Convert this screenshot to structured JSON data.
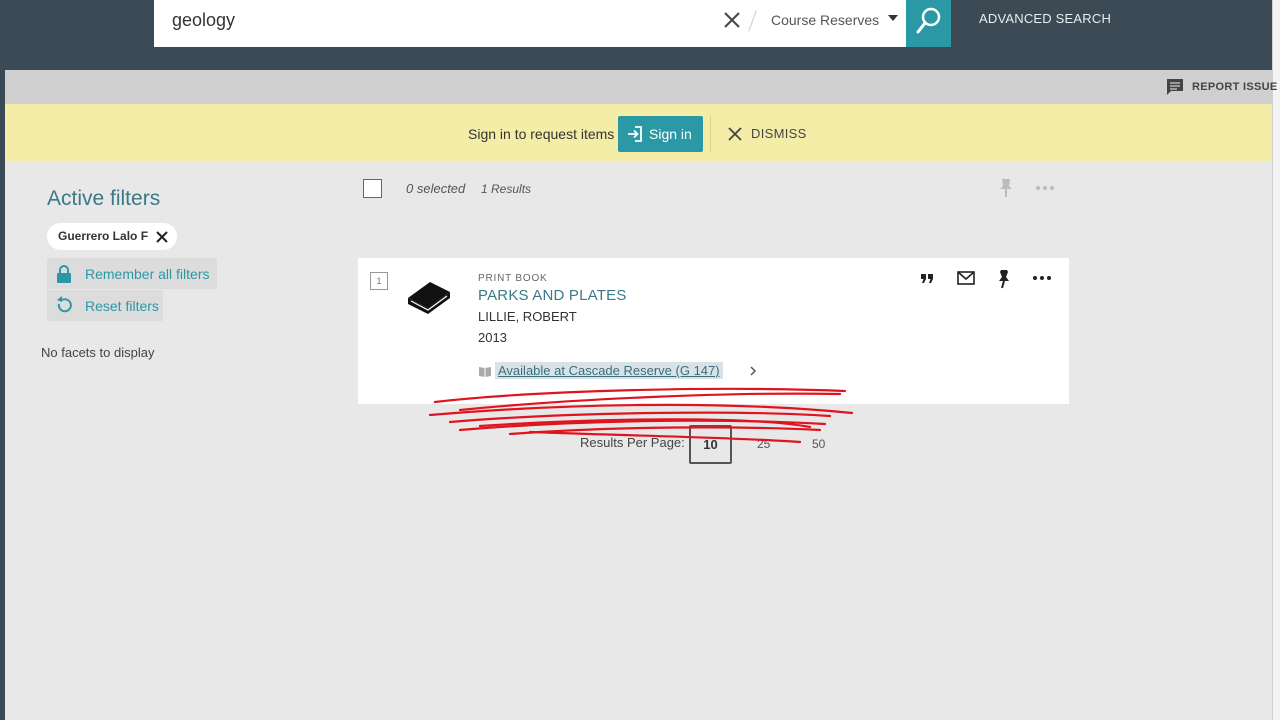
{
  "header": {
    "search_query": "geology",
    "scope": "Course Reserves",
    "advanced_search": "ADVANCED SEARCH"
  },
  "report_bar": {
    "label": "REPORT ISSUE"
  },
  "signin_banner": {
    "text": "Sign in to request items",
    "button_label": "Sign in",
    "dismiss_label": "DISMISS"
  },
  "sidebar": {
    "title": "Active filters",
    "chip_label": "Guerrero Lalo F",
    "remember_label": "Remember all filters",
    "reset_label": "Reset filters",
    "no_facets": "No facets to display"
  },
  "results_header": {
    "selected": "0 selected",
    "count": "1 Results"
  },
  "result": {
    "number": "1",
    "type": "PRINT BOOK",
    "title": "PARKS AND PLATES",
    "author": "LILLIE, ROBERT",
    "year": "2013",
    "availability": "Available at Cascade  Reserve (G 147)"
  },
  "pagination": {
    "label": "Results Per Page:",
    "options": [
      "10",
      "25",
      "50"
    ],
    "selected": "10"
  },
  "colors": {
    "header": "#3b4a55",
    "accent": "#2b98a6",
    "banner": "#f3eda8",
    "link": "#3a7a86",
    "annotation": "#e0141e"
  }
}
